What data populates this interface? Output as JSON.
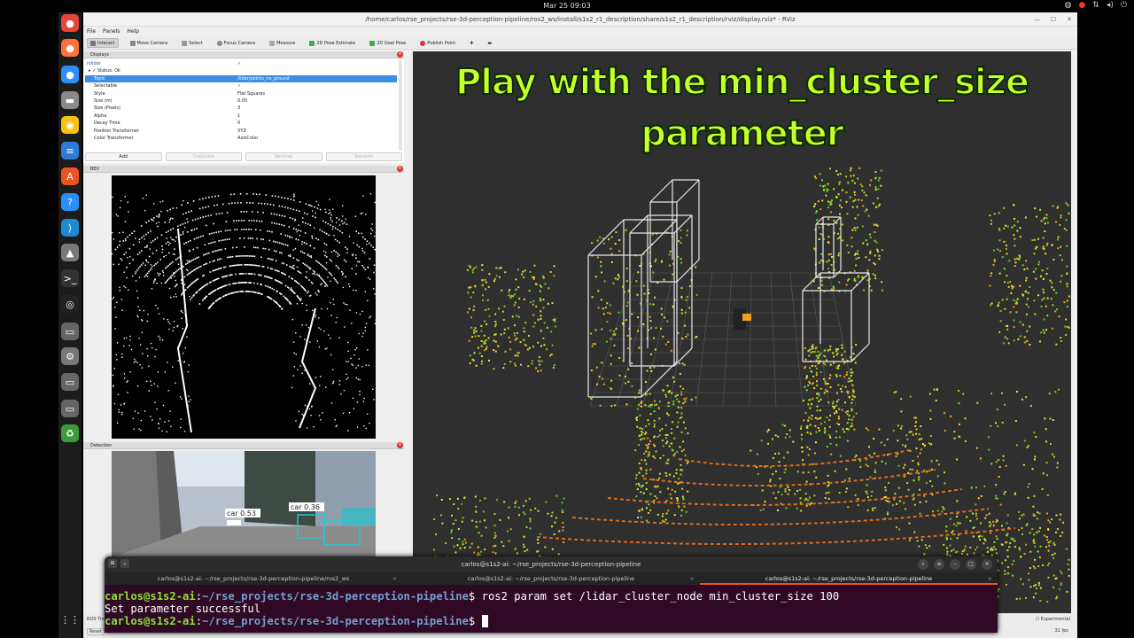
{
  "topbar": {
    "datetime": "Mar 25  09:03"
  },
  "dock": {
    "apps": [
      {
        "name": "chrome-icon",
        "color": "#e8453c",
        "glyph": "●"
      },
      {
        "name": "firefox-icon",
        "color": "#ff7139",
        "glyph": "●"
      },
      {
        "name": "thunderbird-icon",
        "color": "#2a8ff7",
        "glyph": "●"
      },
      {
        "name": "files-icon",
        "color": "#8a8a8a",
        "glyph": "▬"
      },
      {
        "name": "rhythmbox-icon",
        "color": "#f5c211",
        "glyph": "◉"
      },
      {
        "name": "writer-icon",
        "color": "#2e7bd6",
        "glyph": "≡"
      },
      {
        "name": "app-center-icon",
        "color": "#e95420",
        "glyph": "A"
      },
      {
        "name": "help-icon",
        "color": "#2a8ff7",
        "glyph": "?"
      },
      {
        "name": "vscode-icon",
        "color": "#1f8ad2",
        "glyph": "⟩"
      },
      {
        "name": "gazebo-icon",
        "color": "#7a7a7a",
        "glyph": "▲"
      },
      {
        "name": "terminal-icon",
        "color": "#333333",
        "glyph": ">_"
      },
      {
        "name": "obs-icon",
        "color": "#222222",
        "glyph": "◎"
      },
      {
        "name": "drive-icon",
        "color": "#666666",
        "glyph": "▭"
      },
      {
        "name": "settings-icon",
        "color": "#777777",
        "glyph": "⚙"
      },
      {
        "name": "drive2-icon",
        "color": "#666666",
        "glyph": "▭"
      },
      {
        "name": "drive3-icon",
        "color": "#666666",
        "glyph": "▭"
      },
      {
        "name": "trash-icon",
        "color": "#3c9a3c",
        "glyph": "♻"
      },
      {
        "name": "show-apps-icon",
        "color": "#1c1c1c",
        "glyph": "⋮⋮"
      }
    ]
  },
  "window": {
    "title": "/home/carlos/rse_projects/rse-3d-perception-pipeline/ros2_ws/install/s1s2_r1_description/share/s1s2_r1_description/rviz/display.rviz* - RViz"
  },
  "menu": {
    "file": "File",
    "panels": "Panels",
    "help": "Help"
  },
  "toolbar": {
    "interact": "Interact",
    "move_camera": "Move Camera",
    "select": "Select",
    "focus_camera": "Focus Camera",
    "measure": "Measure",
    "pose_estimate": "2D Pose Estimate",
    "goal_pose": "2D Goal Pose",
    "publish_point": "Publish Point"
  },
  "displays": {
    "title": "Displays",
    "rows": [
      {
        "key": "rslidar",
        "val": "✓",
        "indent": 2,
        "sel": false
      },
      {
        "key": "▸  ✓  Status: Ok",
        "val": "",
        "indent": 4,
        "sel": false
      },
      {
        "key": "Topic",
        "val": "/lidar/points_no_ground",
        "indent": 10,
        "sel": true
      },
      {
        "key": "Selectable",
        "val": "✓",
        "indent": 10,
        "sel": false
      },
      {
        "key": "Style",
        "val": "Flat Squares",
        "indent": 10,
        "sel": false
      },
      {
        "key": "Size (m)",
        "val": "0.05",
        "indent": 10,
        "sel": false
      },
      {
        "key": "Size (Pixels)",
        "val": "3",
        "indent": 10,
        "sel": false
      },
      {
        "key": "Alpha",
        "val": "1",
        "indent": 10,
        "sel": false
      },
      {
        "key": "Decay Time",
        "val": "0",
        "indent": 10,
        "sel": false
      },
      {
        "key": "Position Transformer",
        "val": "XYZ",
        "indent": 10,
        "sel": false
      },
      {
        "key": "Color Transformer",
        "val": "AxisColor",
        "indent": 10,
        "sel": false
      }
    ],
    "buttons": {
      "add": "Add",
      "duplicate": "Duplicate",
      "remove": "Remove",
      "rename": "Rename"
    }
  },
  "bev": {
    "title": "BEV"
  },
  "detection": {
    "title": "Detection",
    "labels": [
      "car 0.53",
      "car 0.36"
    ]
  },
  "overlay": {
    "line1": "Play with the min_cluster_size",
    "line2": "parameter"
  },
  "statusbar": {
    "reset": "Reset",
    "ros_time": "ROS Time",
    "experimental": "Experimental",
    "fps": "31 fps"
  },
  "terminal": {
    "title": "carlos@s1s2-ai: ~/rse_projects/rse-3d-perception-pipeline",
    "tabs": [
      {
        "label": "carlos@s1s2-ai: ~/rse_projects/rse-3d-perception-pipeline/ros2_ws"
      },
      {
        "label": "carlos@s1s2-ai: ~/rse_projects/rse-3d-perception-pipeline"
      },
      {
        "label": "carlos@s1s2-ai: ~/rse_projects/rse-3d-perception-pipeline"
      }
    ],
    "prompt_user": "carlos@s1s2-ai",
    "prompt_path": "~/rse_projects/rse-3d-perception-pipeline",
    "command": "ros2 param set /lidar_cluster_node min_cluster_size 100",
    "output": "Set parameter successful"
  }
}
